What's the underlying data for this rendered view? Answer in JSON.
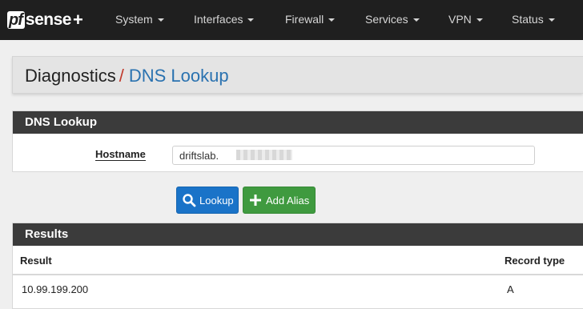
{
  "brand": {
    "logo_pf": "pf",
    "logo_rest": "sense",
    "logo_plus": "+"
  },
  "nav": {
    "items": [
      {
        "label": "System"
      },
      {
        "label": "Interfaces"
      },
      {
        "label": "Firewall"
      },
      {
        "label": "Services"
      },
      {
        "label": "VPN"
      },
      {
        "label": "Status"
      }
    ]
  },
  "breadcrumb": {
    "parent": "Diagnostics",
    "separator": "/",
    "current": "DNS Lookup"
  },
  "lookup_panel": {
    "title": "DNS Lookup",
    "hostname_label": "Hostname",
    "hostname_value": "driftslab."
  },
  "buttons": {
    "lookup_label": "Lookup",
    "add_alias_label": "Add Alias"
  },
  "results": {
    "title": "Results",
    "columns": [
      "Result",
      "Record type"
    ],
    "rows": [
      {
        "result": "10.99.199.200",
        "record_type": "A"
      }
    ]
  },
  "colors": {
    "nav_bg": "#1f1f1f",
    "panel_header": "#3b3b3b",
    "link_blue": "#2a72b0",
    "breadcrumb_sep": "#c0392b",
    "lookup_button": "#1a73c8",
    "alias_button": "#3f9a3f"
  },
  "icons": {
    "lookup": "search-icon",
    "add_alias": "plus-icon",
    "nav_dropdown": "caret-down-icon"
  }
}
